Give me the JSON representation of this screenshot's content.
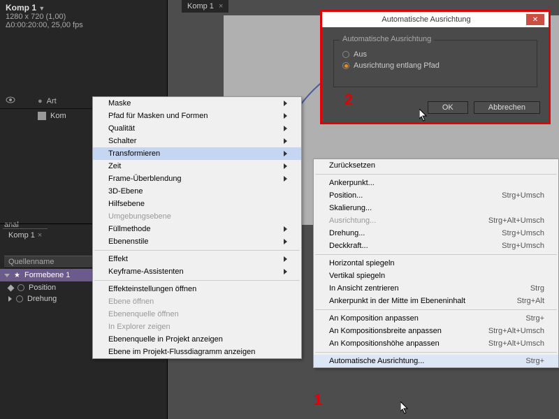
{
  "comp": {
    "title": "Komp 1",
    "dims": "1280 x 720 (1,00)",
    "duration": "Δ0:00:20:00, 25,00 fps",
    "tab": "Komp 1"
  },
  "artRow": {
    "label": "Art"
  },
  "layerRow": {
    "name": "Kom"
  },
  "sidePanel": {
    "anal": "anal"
  },
  "timeline": {
    "tab": "Komp 1",
    "colHeader": "Quellenname",
    "layerName": "Formebene 1",
    "prop1": "Position",
    "prop2": "Drehung"
  },
  "menu1": {
    "items": [
      {
        "label": "Maske",
        "sub": true
      },
      {
        "label": "Pfad für Masken und Formen",
        "sub": true
      },
      {
        "label": "Qualität",
        "sub": true
      },
      {
        "label": "Schalter",
        "sub": true
      },
      {
        "label": "Transformieren",
        "sub": true,
        "hl": true
      },
      {
        "label": "Zeit",
        "sub": true
      },
      {
        "label": "Frame-Überblendung",
        "sub": true
      },
      {
        "label": "3D-Ebene"
      },
      {
        "label": "Hilfsebene"
      },
      {
        "label": "Umgebungsebene",
        "disabled": true
      },
      {
        "label": "Füllmethode",
        "sub": true
      },
      {
        "label": "Ebenenstile",
        "sub": true
      }
    ],
    "sep1": true,
    "items2": [
      {
        "label": "Effekt",
        "sub": true
      },
      {
        "label": "Keyframe-Assistenten",
        "sub": true
      }
    ],
    "sep2": true,
    "items3": [
      {
        "label": "Effekteinstellungen öffnen"
      },
      {
        "label": "Ebene öffnen",
        "disabled": true
      },
      {
        "label": "Ebenenquelle öffnen",
        "disabled": true
      },
      {
        "label": "In Explorer zeigen",
        "disabled": true
      },
      {
        "label": "Ebenenquelle in Projekt anzeigen"
      },
      {
        "label": "Ebene im Projekt-Flussdiagramm anzeigen"
      }
    ]
  },
  "menu2": {
    "zurueck": "Zurücksetzen",
    "group1": [
      {
        "label": "Ankerpunkt..."
      },
      {
        "label": "Position...",
        "short": "Strg+Umsch"
      },
      {
        "label": "Skalierung..."
      },
      {
        "label": "Ausrichtung...",
        "short": "Strg+Alt+Umsch",
        "disabled": true
      },
      {
        "label": "Drehung...",
        "short": "Strg+Umsch"
      },
      {
        "label": "Deckkraft...",
        "short": "Strg+Umsch"
      }
    ],
    "group2": [
      {
        "label": "Horizontal spiegeln"
      },
      {
        "label": "Vertikal spiegeln"
      },
      {
        "label": "In Ansicht zentrieren",
        "short": "Strg"
      },
      {
        "label": "Ankerpunkt in der Mitte im Ebeneninhalt",
        "short": "Strg+Alt"
      }
    ],
    "group3": [
      {
        "label": "An Komposition anpassen",
        "short": "Strg+"
      },
      {
        "label": "An Kompositionsbreite anpassen",
        "short": "Strg+Alt+Umsch"
      },
      {
        "label": "An Kompositionshöhe anpassen",
        "short": "Strg+Alt+Umsch"
      }
    ],
    "auto": {
      "label": "Automatische Ausrichtung...",
      "short": "Strg+"
    }
  },
  "dialog": {
    "title": "Automatische Ausrichtung",
    "legend": "Automatische Ausrichtung",
    "opt1": "Aus",
    "opt2": "Ausrichtung entlang Pfad",
    "ok": "OK",
    "cancel": "Abbrechen"
  },
  "red": {
    "n1": "1",
    "n2": "2"
  }
}
